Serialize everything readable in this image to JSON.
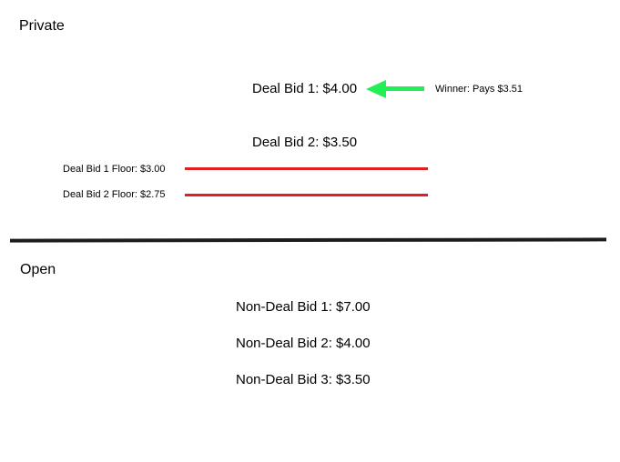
{
  "private": {
    "title": "Private",
    "deal_bid_1": "Deal Bid 1: $4.00",
    "deal_bid_2": "Deal Bid 2: $3.50",
    "winner_note": "Winner: Pays $3.51",
    "floor_1": "Deal Bid 1 Floor: $3.00",
    "floor_2": "Deal Bid 2 Floor: $2.75"
  },
  "open": {
    "title": "Open",
    "bids": [
      "Non-Deal Bid 1: $7.00",
      "Non-Deal Bid 2: $4.00",
      "Non-Deal Bid 3: $3.50"
    ]
  },
  "colors": {
    "floor_line": "#e02020",
    "winner_arrow": "#22ee55",
    "divider": "#1c1c1c"
  }
}
